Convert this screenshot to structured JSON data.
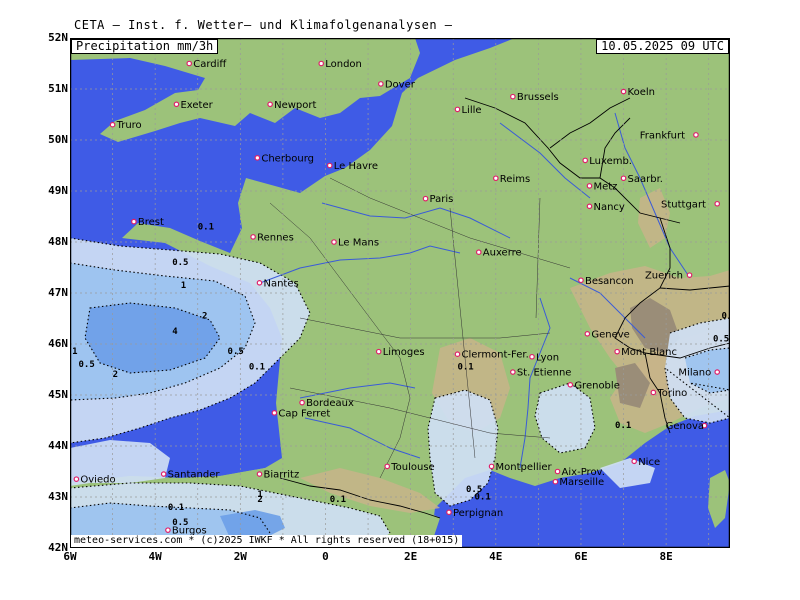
{
  "header": {
    "title": "CETA – Inst. f. Wetter– und Klimafolgenanalysen –"
  },
  "map": {
    "parameter_label": "Precipitation  mm/3h",
    "valid_time": "10.05.2025  09 UTC",
    "credits": "meteo-services.com * (c)2025 IWKF * All rights reserved (18+015)",
    "lat_range": [
      42,
      52
    ],
    "lon_range": [
      -6,
      9.5
    ],
    "lat_labels": [
      {
        "value": 52,
        "text": "52N"
      },
      {
        "value": 51,
        "text": "51N"
      },
      {
        "value": 50,
        "text": "50N"
      },
      {
        "value": 49,
        "text": "49N"
      },
      {
        "value": 48,
        "text": "48N"
      },
      {
        "value": 47,
        "text": "47N"
      },
      {
        "value": 46,
        "text": "46N"
      },
      {
        "value": 45,
        "text": "45N"
      },
      {
        "value": 44,
        "text": "44N"
      },
      {
        "value": 43,
        "text": "43N"
      },
      {
        "value": 42,
        "text": "42N"
      }
    ],
    "lon_labels": [
      {
        "value": -6,
        "text": "6W"
      },
      {
        "value": -4,
        "text": "4W"
      },
      {
        "value": -2,
        "text": "2W"
      },
      {
        "value": 0,
        "text": "0"
      },
      {
        "value": 2,
        "text": "2E"
      },
      {
        "value": 4,
        "text": "4E"
      },
      {
        "value": 6,
        "text": "6E"
      },
      {
        "value": 8,
        "text": "8E"
      }
    ],
    "colors": {
      "sea": "#3f5be6",
      "land": "#9cc27a",
      "mountain": "#c8b489",
      "peak": "#9a8d78",
      "precip_light": "#cfe0f4",
      "precip_mid": "#9ac2ef",
      "precip_heavy": "#6b9fe8",
      "border": "#000000",
      "river": "#3a5bd8",
      "city_marker": "#e0206a",
      "grid": "#9a9a9a"
    },
    "cities": [
      {
        "name": "Cardiff",
        "lon": -3.2,
        "lat": 51.5
      },
      {
        "name": "London",
        "lon": -0.1,
        "lat": 51.5
      },
      {
        "name": "Dover",
        "lon": 1.3,
        "lat": 51.1
      },
      {
        "name": "Exeter",
        "lon": -3.5,
        "lat": 50.7
      },
      {
        "name": "Newport",
        "lon": -1.3,
        "lat": 50.7
      },
      {
        "name": "Truro",
        "lon": -5.0,
        "lat": 50.3
      },
      {
        "name": "Lille",
        "lon": 3.1,
        "lat": 50.6
      },
      {
        "name": "Brussels",
        "lon": 4.4,
        "lat": 50.85
      },
      {
        "name": "Koeln",
        "lon": 7.0,
        "lat": 50.95
      },
      {
        "name": "Frankfurt",
        "lon": 8.7,
        "lat": 50.1
      },
      {
        "name": "Cherbourg",
        "lon": -1.6,
        "lat": 49.65
      },
      {
        "name": "Le Havre",
        "lon": 0.1,
        "lat": 49.5
      },
      {
        "name": "Luxemb.",
        "lon": 6.1,
        "lat": 49.6
      },
      {
        "name": "Reims",
        "lon": 4.0,
        "lat": 49.25
      },
      {
        "name": "Saarbr.",
        "lon": 7.0,
        "lat": 49.25
      },
      {
        "name": "Metz",
        "lon": 6.2,
        "lat": 49.1
      },
      {
        "name": "Paris",
        "lon": 2.35,
        "lat": 48.85
      },
      {
        "name": "Nancy",
        "lon": 6.2,
        "lat": 48.7
      },
      {
        "name": "Stuttgart",
        "lon": 9.2,
        "lat": 48.75
      },
      {
        "name": "Brest",
        "lon": -4.5,
        "lat": 48.4
      },
      {
        "name": "Rennes",
        "lon": -1.7,
        "lat": 48.1
      },
      {
        "name": "Le Mans",
        "lon": 0.2,
        "lat": 48.0
      },
      {
        "name": "Auxerre",
        "lon": 3.6,
        "lat": 47.8
      },
      {
        "name": "Zuerich",
        "lon": 8.55,
        "lat": 47.35
      },
      {
        "name": "Nantes",
        "lon": -1.55,
        "lat": 47.2
      },
      {
        "name": "Besancon",
        "lon": 6.0,
        "lat": 47.25
      },
      {
        "name": "Geneve",
        "lon": 6.15,
        "lat": 46.2
      },
      {
        "name": "Limoges",
        "lon": 1.25,
        "lat": 45.85
      },
      {
        "name": "Clermont-Fer.",
        "lon": 3.1,
        "lat": 45.8
      },
      {
        "name": "Mont Blanc",
        "lon": 6.85,
        "lat": 45.85
      },
      {
        "name": "Lyon",
        "lon": 4.85,
        "lat": 45.75
      },
      {
        "name": "St. Etienne",
        "lon": 4.4,
        "lat": 45.45
      },
      {
        "name": "Milano",
        "lon": 9.2,
        "lat": 45.45
      },
      {
        "name": "Grenoble",
        "lon": 5.75,
        "lat": 45.2
      },
      {
        "name": "Bordeaux",
        "lon": -0.55,
        "lat": 44.85
      },
      {
        "name": "Torino",
        "lon": 7.7,
        "lat": 45.05
      },
      {
        "name": "Cap Ferret",
        "lon": -1.2,
        "lat": 44.65
      },
      {
        "name": "Genova",
        "lon": 8.9,
        "lat": 44.4
      },
      {
        "name": "Nice",
        "lon": 7.25,
        "lat": 43.7
      },
      {
        "name": "Montpellier",
        "lon": 3.9,
        "lat": 43.6
      },
      {
        "name": "Toulouse",
        "lon": 1.45,
        "lat": 43.6
      },
      {
        "name": "Aix-Prov.",
        "lon": 5.45,
        "lat": 43.5
      },
      {
        "name": "Biarritz",
        "lon": -1.55,
        "lat": 43.45
      },
      {
        "name": "Oviedo",
        "lon": -5.85,
        "lat": 43.35
      },
      {
        "name": "Santander",
        "lon": -3.8,
        "lat": 43.45
      },
      {
        "name": "Marseille",
        "lon": 5.4,
        "lat": 43.3
      },
      {
        "name": "Perpignan",
        "lon": 2.9,
        "lat": 42.7
      },
      {
        "name": "Burgos",
        "lon": -3.7,
        "lat": 42.35
      }
    ],
    "contour_labels": [
      {
        "text": "0.1",
        "lon": -3.0,
        "lat": 48.25
      },
      {
        "text": "0.5",
        "lon": -3.6,
        "lat": 47.55
      },
      {
        "text": "1",
        "lon": -3.4,
        "lat": 47.1
      },
      {
        "text": "2",
        "lon": -2.9,
        "lat": 46.5
      },
      {
        "text": "4",
        "lon": -3.6,
        "lat": 46.2
      },
      {
        "text": "0.5",
        "lon": -2.3,
        "lat": 45.8
      },
      {
        "text": "1",
        "lon": -5.95,
        "lat": 45.8
      },
      {
        "text": "0.5",
        "lon": -5.8,
        "lat": 45.55
      },
      {
        "text": "2",
        "lon": -5.0,
        "lat": 45.35
      },
      {
        "text": "0.1",
        "lon": -1.8,
        "lat": 45.5
      },
      {
        "text": "0.1",
        "lon": 3.1,
        "lat": 45.5
      },
      {
        "text": "0.1",
        "lon": 0.1,
        "lat": 42.9
      },
      {
        "text": "1",
        "lon": -1.6,
        "lat": 43.0
      },
      {
        "text": "2",
        "lon": -1.6,
        "lat": 42.9
      },
      {
        "text": "0.1",
        "lon": -3.7,
        "lat": 42.75
      },
      {
        "text": "0.5",
        "lon": -3.6,
        "lat": 42.45
      },
      {
        "text": "0.5",
        "lon": 3.3,
        "lat": 43.1
      },
      {
        "text": "0.1",
        "lon": 3.5,
        "lat": 42.95
      },
      {
        "text": "0.1",
        "lon": 6.8,
        "lat": 44.35
      },
      {
        "text": "0.1",
        "lon": 9.3,
        "lat": 46.5
      },
      {
        "text": "0.5",
        "lon": 9.1,
        "lat": 46.05
      }
    ]
  }
}
